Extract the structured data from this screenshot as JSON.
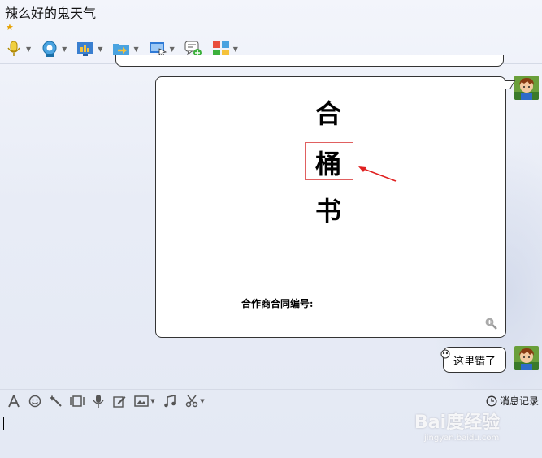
{
  "window": {
    "title": "辣么好的鬼天气",
    "star_icon": "star-icon"
  },
  "toolbar": {
    "items": [
      {
        "name": "microphone-icon",
        "dropdown": true
      },
      {
        "name": "webcam-icon",
        "dropdown": true
      },
      {
        "name": "screen-share-icon",
        "dropdown": true
      },
      {
        "name": "send-file-icon",
        "dropdown": true
      },
      {
        "name": "remote-desktop-icon",
        "dropdown": true
      },
      {
        "name": "message-add-icon",
        "dropdown": false
      },
      {
        "name": "apps-grid-icon",
        "dropdown": true
      }
    ]
  },
  "messages": [
    {
      "type": "image",
      "document": {
        "char1": "合",
        "char2": "桶",
        "char3": "书",
        "contract_label": "合作商合同编号:"
      }
    },
    {
      "type": "text",
      "text": "这里错了"
    }
  ],
  "composer": {
    "tools": [
      "font-icon",
      "emoji-icon",
      "magic-icon",
      "screenshot-icon",
      "voice-icon",
      "edit-icon",
      "image-icon",
      "music-icon",
      "scissors-icon"
    ],
    "history_label": "消息记录"
  },
  "watermark": {
    "text": "Bai度经验",
    "sub": "jingyan.baidu.com"
  },
  "colors": {
    "accent": "#e06060",
    "border": "#333333",
    "background": "#e9edf6"
  }
}
